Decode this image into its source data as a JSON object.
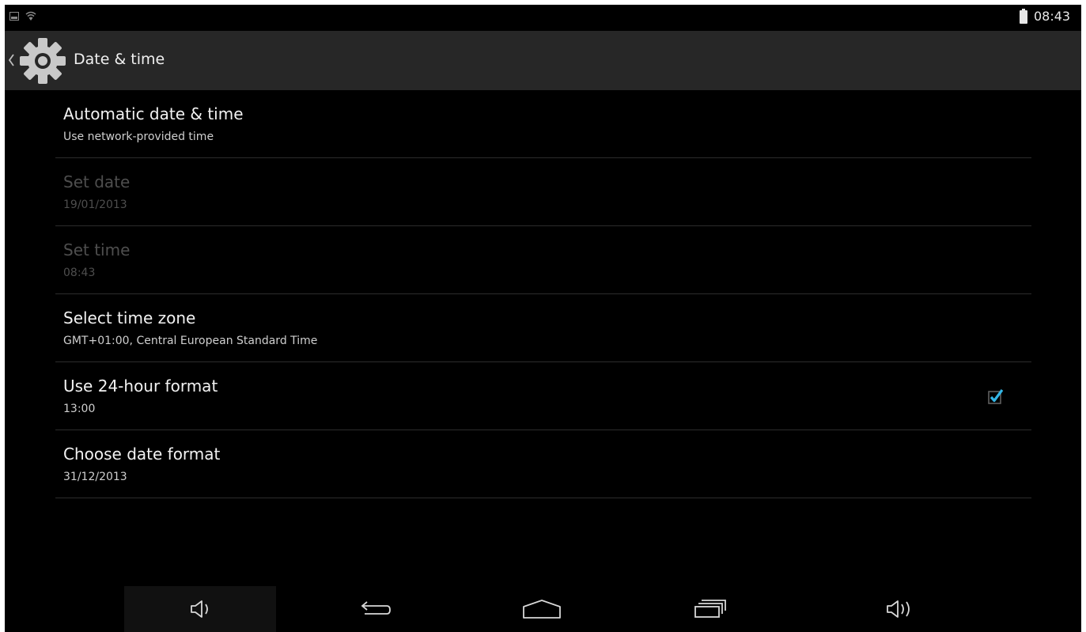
{
  "status_bar": {
    "left_icons": [
      "screenshot-icon",
      "wifi-icon"
    ],
    "battery_icon": "battery-icon",
    "time": "08:43"
  },
  "action_bar": {
    "back_icon": "chevron-left-icon",
    "app_icon": "gear-icon",
    "title": "Date & time"
  },
  "settings": [
    {
      "title": "Automatic date & time",
      "summary": "Use network-provided time",
      "enabled": true
    },
    {
      "title": "Set date",
      "summary": "19/01/2013",
      "enabled": false
    },
    {
      "title": "Set time",
      "summary": "08:43",
      "enabled": false
    },
    {
      "title": "Select time zone",
      "summary": "GMT+01:00, Central European Standard Time",
      "enabled": true
    },
    {
      "title": "Use 24-hour format",
      "summary": "13:00",
      "enabled": true,
      "checked": true
    },
    {
      "title": "Choose date format",
      "summary": "31/12/2013",
      "enabled": true
    }
  ],
  "nav_bar": [
    "volume-down-icon",
    "back-icon",
    "home-icon",
    "recent-apps-icon",
    "volume-up-icon"
  ],
  "colors": {
    "background": "#000000",
    "action_bar": "#272727",
    "accent": "#33b5e5",
    "disabled_text": "#4e4e4e"
  }
}
